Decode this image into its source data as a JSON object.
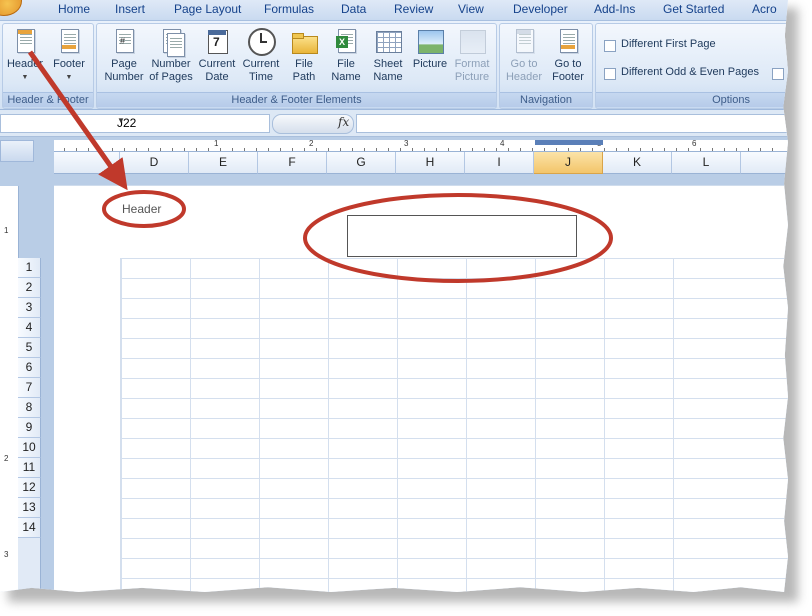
{
  "ribbon_tabs": [
    "Home",
    "Insert",
    "Page Layout",
    "Formulas",
    "Data",
    "Review",
    "View",
    "Developer",
    "Add-Ins",
    "Get Started",
    "Acro"
  ],
  "header_footer_group": {
    "label": "Header & Footer",
    "header_btn": "Header",
    "footer_btn": "Footer"
  },
  "elements_group": {
    "label": "Header & Footer Elements",
    "page_number": [
      "Page",
      "Number"
    ],
    "number_of_pages": [
      "Number",
      "of Pages"
    ],
    "current_date": [
      "Current",
      "Date"
    ],
    "current_time": [
      "Current",
      "Time"
    ],
    "file_path": [
      "File",
      "Path"
    ],
    "file_name": [
      "File",
      "Name"
    ],
    "sheet_name": [
      "Sheet",
      "Name"
    ],
    "picture": "Picture",
    "format_picture": [
      "Format",
      "Picture"
    ],
    "calendar_day": "7"
  },
  "navigation_group": {
    "label": "Navigation",
    "go_to_header": [
      "Go to",
      "Header"
    ],
    "go_to_footer": [
      "Go to",
      "Footer"
    ]
  },
  "options_group": {
    "label": "Options",
    "different_first_page": "Different First Page",
    "different_odd_even": "Different Odd & Even Pages"
  },
  "formula_bar": {
    "name_box": "J22",
    "fx": "fx",
    "formula": ""
  },
  "ruler_numbers": [
    "1",
    "2",
    "3",
    "4",
    "5",
    "6"
  ],
  "vruler_numbers": [
    "1",
    "2",
    "3"
  ],
  "columns": [
    "D",
    "E",
    "F",
    "G",
    "H",
    "I",
    "J",
    "K",
    "L"
  ],
  "selected_column": "J",
  "rows": [
    "1",
    "2",
    "3",
    "4",
    "5",
    "6",
    "7",
    "8",
    "9",
    "10",
    "11",
    "12",
    "13",
    "14"
  ],
  "header_section_text": "Header",
  "colors": {
    "annotation": "#c0392b",
    "ribbon_text": "#15428b",
    "selected_column": "#f3c56a"
  }
}
